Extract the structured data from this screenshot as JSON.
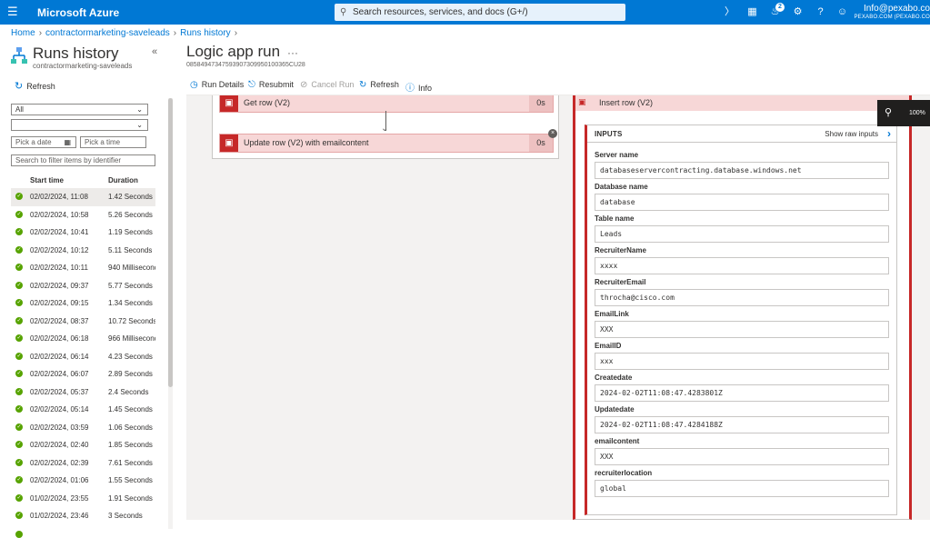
{
  "topbar": {
    "brand": "Microsoft Azure",
    "search_placeholder": "Search resources, services, and docs (G+/)",
    "notification_count": "2",
    "user_email": "Info@pexabo.co",
    "user_tenant": "PEXABO.COM (PEXABO.CO"
  },
  "breadcrumb": {
    "home": "Home",
    "app": "contractormarketing-saveleads",
    "runs": "Runs history"
  },
  "left": {
    "title": "Runs history",
    "subtitle": "contractormarketing-saveleads",
    "refresh": "Refresh",
    "status_filter": "All",
    "second_filter": "",
    "date_placeholder": "Pick a date",
    "time_placeholder": "Pick a time",
    "identifier_placeholder": "Search to filter items by identifier",
    "col_start": "Start time",
    "col_duration": "Duration",
    "runs": [
      {
        "start": "02/02/2024, 11:08",
        "duration": "1.42 Seconds"
      },
      {
        "start": "02/02/2024, 10:58",
        "duration": "5.26 Seconds"
      },
      {
        "start": "02/02/2024, 10:41",
        "duration": "1.19 Seconds"
      },
      {
        "start": "02/02/2024, 10:12",
        "duration": "5.11 Seconds"
      },
      {
        "start": "02/02/2024, 10:11",
        "duration": "940 Milliseconds"
      },
      {
        "start": "02/02/2024, 09:37",
        "duration": "5.77 Seconds"
      },
      {
        "start": "02/02/2024, 09:15",
        "duration": "1.34 Seconds"
      },
      {
        "start": "02/02/2024, 08:37",
        "duration": "10.72 Seconds"
      },
      {
        "start": "02/02/2024, 06:18",
        "duration": "966 Milliseconds"
      },
      {
        "start": "02/02/2024, 06:14",
        "duration": "4.23 Seconds"
      },
      {
        "start": "02/02/2024, 06:07",
        "duration": "2.89 Seconds"
      },
      {
        "start": "02/02/2024, 05:37",
        "duration": "2.4 Seconds"
      },
      {
        "start": "02/02/2024, 05:14",
        "duration": "1.45 Seconds"
      },
      {
        "start": "02/02/2024, 03:59",
        "duration": "1.06 Seconds"
      },
      {
        "start": "02/02/2024, 02:40",
        "duration": "1.85 Seconds"
      },
      {
        "start": "02/02/2024, 02:39",
        "duration": "7.61 Seconds"
      },
      {
        "start": "02/02/2024, 01:06",
        "duration": "1.55 Seconds"
      },
      {
        "start": "01/02/2024, 23:55",
        "duration": "1.91 Seconds"
      },
      {
        "start": "01/02/2024, 23:46",
        "duration": "3 Seconds"
      }
    ]
  },
  "run": {
    "title": "Logic app run",
    "more": "···",
    "run_id": "08584947347593907309950100365CU28",
    "toolbar": {
      "details": "Run Details",
      "resubmit": "Resubmit",
      "cancel": "Cancel Run",
      "refresh": "Refresh",
      "info": "Info"
    },
    "steps": [
      {
        "name": "Get row (V2)",
        "duration": "0s"
      },
      {
        "name": "Update row (V2) with emailcontent",
        "duration": "0s"
      }
    ],
    "zoom": "100%"
  },
  "detail": {
    "step_name": "Insert row (V2)",
    "inputs_label": "INPUTS",
    "show_raw": "Show raw inputs",
    "fields": [
      {
        "label": "Server name",
        "value": "databaseservercontracting.database.windows.net"
      },
      {
        "label": "Database name",
        "value": "database"
      },
      {
        "label": "Table name",
        "value": "Leads"
      },
      {
        "label": "RecruiterName",
        "value": "xxxx"
      },
      {
        "label": "RecruiterEmail",
        "value": "throcha@cisco.com"
      },
      {
        "label": "EmailLink",
        "value": "XXX"
      },
      {
        "label": "EmailID",
        "value": "xxx"
      },
      {
        "label": "Createdate",
        "value": "2024-02-02T11:08:47.4283801Z"
      },
      {
        "label": "Updatedate",
        "value": "2024-02-02T11:08:47.4284188Z"
      },
      {
        "label": "emailcontent",
        "value": "XXX"
      },
      {
        "label": "recruiterlocation",
        "value": "global"
      }
    ]
  }
}
